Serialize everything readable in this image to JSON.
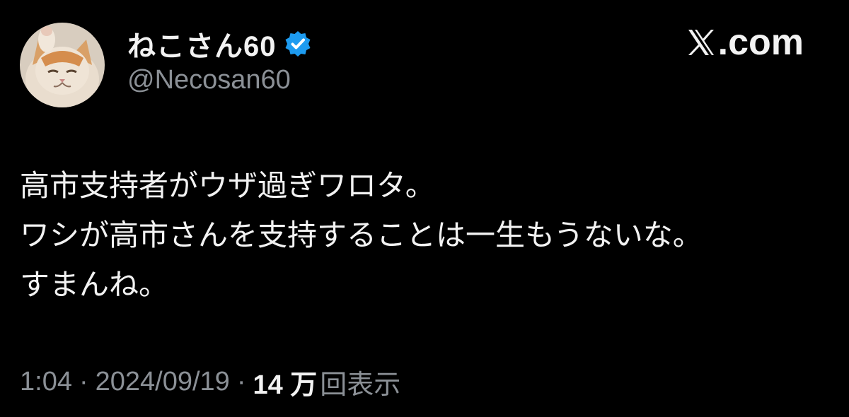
{
  "author": {
    "display_name": "ねこさん60",
    "handle": "@Necosan60",
    "verified": true,
    "avatar": "cat-photo-avatar"
  },
  "brand": {
    "icon": "x-logo-icon",
    "text": ".com"
  },
  "tweet": {
    "lines": [
      "高市支持者がウザ過ぎワロタ。",
      "ワシが高市さんを支持することは一生もうないな。",
      "すまんね。"
    ]
  },
  "meta": {
    "time": "1:04",
    "separator": "·",
    "date": "2024/09/19",
    "views_count": "14 万",
    "views_label": "回表示"
  },
  "colors": {
    "background": "#000000",
    "text": "#f2f2f2",
    "secondary_text": "#8b9096",
    "verified_badge": "#1d9bf0"
  }
}
